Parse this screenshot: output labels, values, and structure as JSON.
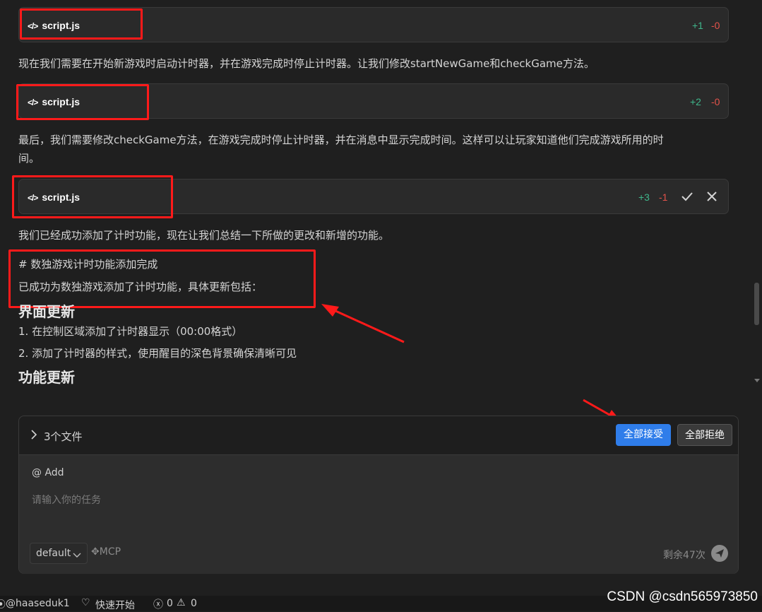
{
  "files": [
    {
      "name": "script.js",
      "added": "+1",
      "removed": "-0"
    },
    {
      "name": "script.js",
      "added": "+2",
      "removed": "-0"
    },
    {
      "name": "script.js",
      "added": "+3",
      "removed": "-1"
    }
  ],
  "messages": {
    "p1": "现在我们需要在开始新游戏时启动计时器，并在游戏完成时停止计时器。让我们修改startNewGame和checkGame方法。",
    "p2_line1": "最后，我们需要修改checkGame方法，在游戏完成时停止计时器，并在消息中显示完成时间。这样可以让玩家知道他们完成游戏所用的时",
    "p2_line2": "间。",
    "p3": "我们已经成功添加了计时功能，现在让我们总结一下所做的更改和新增的功能。",
    "md_heading": "# 数独游戏计时功能添加完成",
    "md_intro": "已成功为数独游戏添加了计时功能，具体更新包括：",
    "section1_title": "界面更新",
    "items1": [
      "1. 在控制区域添加了计时器显示（00:00格式）",
      "2. 添加了计时器的样式，使用醒目的深色背景确保清晰可见"
    ],
    "section2_title": "功能更新"
  },
  "review_panel": {
    "files_count": "3个文件",
    "accept_all": "全部接受",
    "reject_all": "全部拒绝"
  },
  "input": {
    "add_label": "@ Add",
    "placeholder": "请输入你的任务",
    "model": "default",
    "mcp": "MCP",
    "remaining": "剩余47次"
  },
  "statusbar": {
    "user": "@haaseduk1",
    "quickstart": "快速开始",
    "errors": "0",
    "warnings": "0"
  },
  "watermark": "CSDN @csdn565973850",
  "colors": {
    "added": "#3fb68b",
    "removed": "#e5534b",
    "annotation": "#ff1a1a",
    "accent": "#2f7dea"
  }
}
